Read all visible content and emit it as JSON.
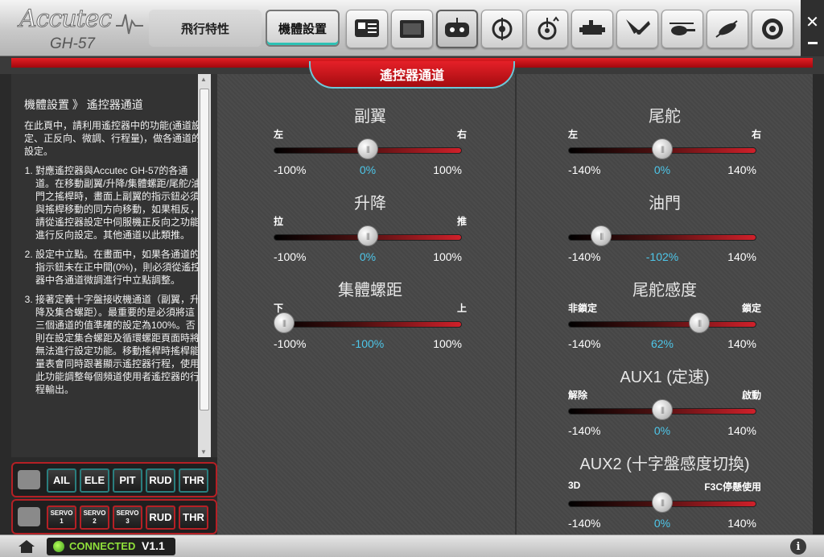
{
  "app": {
    "brand": "Accutec",
    "model": "GH-57"
  },
  "nav": {
    "tab_flight": "飛行特性",
    "tab_setup": "機體設置"
  },
  "toolbar": {
    "icons": [
      "display-setup-icon",
      "screen-icon",
      "transmitter-icon",
      "swashplate-icon",
      "rotor-head-icon",
      "servo-icon",
      "tail-blade-icon",
      "helicopter-icon",
      "heli-flip-icon",
      "gyro-icon"
    ]
  },
  "header": {
    "section_title": "遙控器通道"
  },
  "sidebar": {
    "heading": "機體設置 》 遙控器通道",
    "intro": "在此頁中，請利用遙控器中的功能(通道設定、正反向、微調、行程量)，做各通道的設定。",
    "items": [
      "對應遙控器與Accutec GH-57的各通道。在移動副翼/升降/集體螺距/尾舵/油門之搖桿時，畫面上副翼的指示鈕必須與搖桿移動的同方向移動，如果相反，請從遙控器設定中伺服機正反向之功能進行反向設定。其他通道以此類推。",
      "設定中立點。在畫面中，如果各通道的指示鈕未在正中間(0%)，則必須從遙控器中各通道微調進行中立點調整。",
      "接著定義十字盤接收機通道（副翼，升降及集合螺距）。最重要的是必須將這三個通道的值準確的設定為100%。否則在設定集合螺距及循環螺距頁面時將無法進行設定功能。移動搖桿時搖桿能量表會同時跟著顯示遙控器行程，使用此功能調整每個頻道使用者遙控器的行程輸出。"
    ]
  },
  "channels_row1": [
    "AIL",
    "ELE",
    "PIT",
    "RUD",
    "THR"
  ],
  "channels_row2": [
    {
      "top": "SERVO",
      "bottom": "1"
    },
    {
      "top": "SERVO",
      "bottom": "2"
    },
    {
      "top": "SERVO",
      "bottom": "3"
    },
    {
      "label": "RUD"
    },
    {
      "label": "THR"
    }
  ],
  "sliders": {
    "aileron": {
      "title": "副翼",
      "left": "左",
      "right": "右",
      "min": "-100%",
      "max": "100%",
      "value": "0%",
      "pct": 0,
      "range": 100
    },
    "elevator": {
      "title": "升降",
      "left": "拉",
      "right": "推",
      "min": "-100%",
      "max": "100%",
      "value": "0%",
      "pct": 0,
      "range": 100
    },
    "pitch": {
      "title": "集體螺距",
      "left": "下",
      "right": "上",
      "min": "-100%",
      "max": "100%",
      "value": "-100%",
      "pct": -100,
      "range": 100
    },
    "rudder": {
      "title": "尾舵",
      "left": "左",
      "right": "右",
      "min": "-140%",
      "max": "140%",
      "value": "0%",
      "pct": 0,
      "range": 140
    },
    "throttle": {
      "title": "油門",
      "left": "",
      "right": "",
      "min": "-140%",
      "max": "140%",
      "value": "-102%",
      "pct": -102,
      "range": 140
    },
    "gyro_gain": {
      "title": "尾舵感度",
      "left": "非鎖定",
      "right": "鎖定",
      "min": "-140%",
      "max": "140%",
      "value": "62%",
      "pct": 62,
      "range": 140
    },
    "aux1": {
      "title": "AUX1 (定速)",
      "left": "解除",
      "right": "啟動",
      "min": "-140%",
      "max": "140%",
      "value": "0%",
      "pct": 0,
      "range": 140
    },
    "aux2": {
      "title": "AUX2 (十字盤感度切換)",
      "left": "3D",
      "right": "F3C停懸使用",
      "min": "-140%",
      "max": "140%",
      "value": "0%",
      "pct": 0,
      "range": 140
    }
  },
  "footer": {
    "status": "CONNECTED",
    "version": "V1.1",
    "info": "i"
  },
  "colors": {
    "accent_red": "#d0202a",
    "value_cyan": "#4ec7ea",
    "connected_green": "#8fe03a"
  }
}
